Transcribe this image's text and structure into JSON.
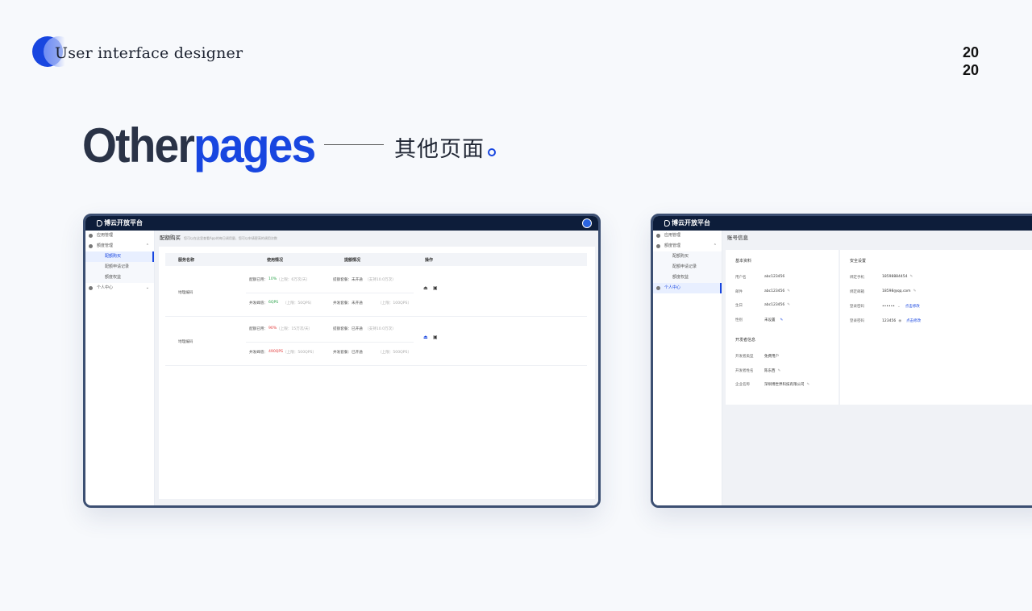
{
  "brand": "User interface designer",
  "year": [
    "20",
    "20"
  ],
  "hero": {
    "en_a": "Other",
    "en_b": "pages",
    "cn": "其他页面"
  },
  "app": {
    "name": "博云开放平台"
  },
  "dev1": {
    "sidebar": [
      {
        "label": "应用管理",
        "kind": "top"
      },
      {
        "label": "额度管理",
        "kind": "top",
        "caret": "^"
      },
      {
        "label": "配额购买",
        "kind": "sub",
        "active": true
      },
      {
        "label": "配额申请记录",
        "kind": "sub"
      },
      {
        "label": "额度权益",
        "kind": "sub"
      },
      {
        "label": "个人中心",
        "kind": "top",
        "caret": "v"
      }
    ],
    "crumb": "配额购买",
    "crumb_hint": "您可以在这里查看App的每日调用量、您可以申请更高的调用次数",
    "headers": [
      "服务名称",
      "使用情况",
      "提额情况",
      "操作"
    ],
    "rows": [
      {
        "name": "地理编码",
        "u1a": "配额已用：",
        "u1b": "10%",
        "u1c": "（上限：6万次/天）",
        "u2a": "并发峰值：",
        "u2b": "6QPS",
        "u2c": "（上限：50QPS）",
        "e1a": "提额套餐：未开通",
        "e1b": "（支持10.0万次）",
        "e2a": "并发套餐：未开通",
        "e2b": "（上限：100QPS）"
      },
      {
        "name": "地理编码",
        "u1a": "配额已用：",
        "u1b": "90%",
        "u1c": "（上限：15万次/天）",
        "u2a": "并发峰值：",
        "u2b": "490QPS",
        "u2c": "（上限：500QPS）",
        "e1a": "提额套餐：已开通",
        "e1b": "（支持10.0万次）",
        "e2a": "并发套餐：已开通",
        "e2b": "（上限：500QPS）"
      }
    ]
  },
  "dev2": {
    "sidebar": [
      {
        "label": "应用管理",
        "kind": "top"
      },
      {
        "label": "额度管理",
        "kind": "top",
        "caret": "^"
      },
      {
        "label": "配额购买",
        "kind": "sub"
      },
      {
        "label": "配额申请记录",
        "kind": "sub"
      },
      {
        "label": "额度权益",
        "kind": "sub"
      },
      {
        "label": "个人中心",
        "kind": "top",
        "active": true
      }
    ],
    "crumb": "账号信息",
    "basic_title": "基本资料",
    "basic": [
      {
        "k": "用户名",
        "v": "abc123456"
      },
      {
        "k": "邮件",
        "v": "abc123456"
      },
      {
        "k": "生日",
        "v": "abc123456"
      },
      {
        "k": "性别",
        "v": "未设置"
      }
    ],
    "dev_title": "开发者信息",
    "devinfo": [
      {
        "k": "开发者类型",
        "v": "免费用户"
      },
      {
        "k": "开发者姓名",
        "v": "陈东西"
      },
      {
        "k": "企业名称",
        "v": "深圳博世界科技有限公司"
      }
    ],
    "sec_title": "安全设置",
    "security": [
      {
        "k": "绑定手机",
        "v": "18598884454",
        "link": ""
      },
      {
        "k": "绑定邮箱",
        "v": "18598@qq.com",
        "link": ""
      },
      {
        "k": "登录密码",
        "v": "••••••",
        "link": "点击修改"
      },
      {
        "k": "登录密码",
        "v": "123456",
        "link": "点击修改"
      }
    ]
  }
}
